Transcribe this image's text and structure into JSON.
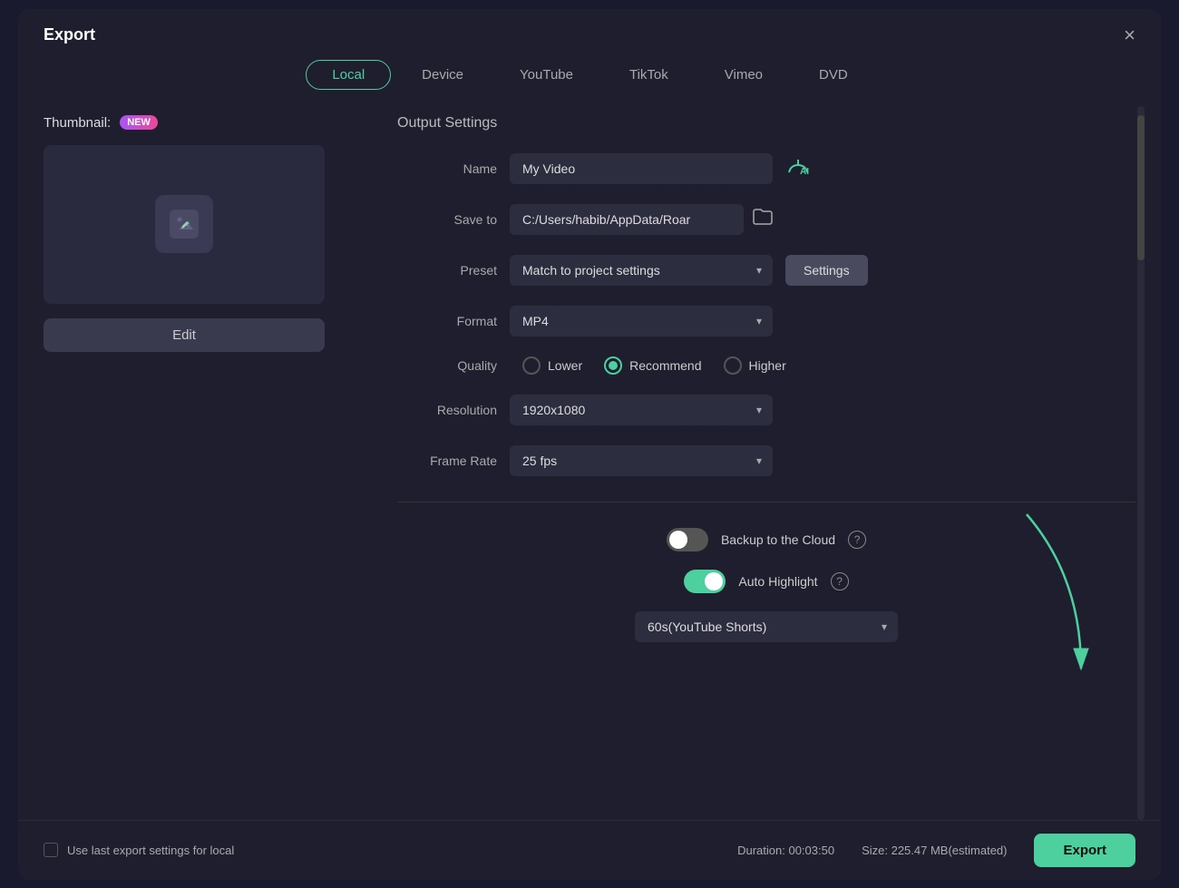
{
  "dialog": {
    "title": "Export",
    "close_label": "×"
  },
  "tabs": [
    {
      "id": "local",
      "label": "Local",
      "active": true
    },
    {
      "id": "device",
      "label": "Device",
      "active": false
    },
    {
      "id": "youtube",
      "label": "YouTube",
      "active": false
    },
    {
      "id": "tiktok",
      "label": "TikTok",
      "active": false
    },
    {
      "id": "vimeo",
      "label": "Vimeo",
      "active": false
    },
    {
      "id": "dvd",
      "label": "DVD",
      "active": false
    }
  ],
  "left_panel": {
    "thumbnail_label": "Thumbnail:",
    "new_badge": "NEW",
    "edit_button": "Edit"
  },
  "output_settings": {
    "title": "Output Settings",
    "name_label": "Name",
    "name_value": "My Video",
    "save_to_label": "Save to",
    "save_to_value": "C:/Users/habib/AppData/Roar",
    "preset_label": "Preset",
    "preset_value": "Match to project settings",
    "settings_button": "Settings",
    "format_label": "Format",
    "format_value": "MP4",
    "quality_label": "Quality",
    "quality_options": [
      {
        "id": "lower",
        "label": "Lower",
        "checked": false
      },
      {
        "id": "recommend",
        "label": "Recommend",
        "checked": true
      },
      {
        "id": "higher",
        "label": "Higher",
        "checked": false
      }
    ],
    "resolution_label": "Resolution",
    "resolution_value": "1920x1080",
    "frame_rate_label": "Frame Rate",
    "frame_rate_value": "25 fps",
    "backup_cloud_label": "Backup to the Cloud",
    "backup_cloud_on": false,
    "auto_highlight_label": "Auto Highlight",
    "auto_highlight_on": true,
    "shorts_value": "60s(YouTube Shorts)"
  },
  "bottom_bar": {
    "use_last_label": "Use last export settings for local",
    "duration_label": "Duration: 00:03:50",
    "size_label": "Size: 225.47 MB(estimated)",
    "export_button": "Export"
  }
}
